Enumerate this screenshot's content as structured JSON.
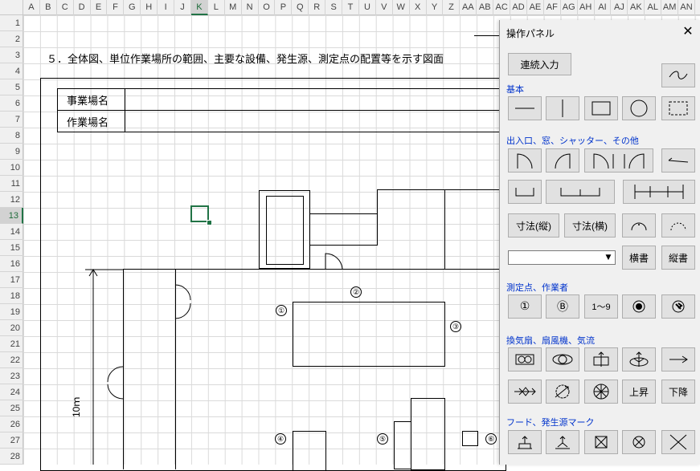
{
  "spreadsheet": {
    "columns": [
      "A",
      "B",
      "C",
      "D",
      "E",
      "F",
      "G",
      "H",
      "I",
      "J",
      "K",
      "L",
      "M",
      "N",
      "O",
      "P",
      "Q",
      "R",
      "S",
      "T",
      "U",
      "V",
      "W",
      "X",
      "Y",
      "Z",
      "AA",
      "AB",
      "AC",
      "AD",
      "AE",
      "AF",
      "AG",
      "AH",
      "AI",
      "AJ",
      "AK",
      "AL",
      "AM",
      "AN"
    ],
    "selected_column": "K",
    "rows": [
      "1",
      "2",
      "3",
      "4",
      "5",
      "6",
      "7",
      "8",
      "9",
      "10",
      "11",
      "12",
      "13",
      "14",
      "15",
      "16",
      "17",
      "18",
      "19",
      "20",
      "21",
      "22",
      "23",
      "24",
      "25",
      "26",
      "27",
      "28"
    ],
    "selected_row": "13"
  },
  "drawing": {
    "heading": "５．全体図、単位作業場所の範囲、主要な設備、発生源、測定点の配置等を示す図面",
    "business_name_label": "事業場名",
    "workplace_name_label": "作業場名",
    "dimension_label": "10ｍ",
    "points": [
      "①",
      "②",
      "③",
      "④",
      "⑤",
      "⑥"
    ]
  },
  "panel": {
    "title": "操作パネル",
    "close_glyph": "✕",
    "continuous_input_label": "連続入力",
    "sections": {
      "basic": "基本",
      "openings": "出入口、窓、シャッター、その他",
      "measure": "測定点、作業者",
      "ventilation": "換気扇、扇風機、気流",
      "hood": "フード、発生源マーク"
    },
    "buttons": {
      "dim_vertical": "寸法(縦)",
      "dim_horizontal": "寸法(横)",
      "text_horizontal": "横書",
      "text_vertical": "縦書",
      "point_range": "1〜9",
      "rise": "上昇",
      "fall": "下降",
      "point_one": "①",
      "point_b": "Ⓑ"
    },
    "dropdown_value": ""
  }
}
